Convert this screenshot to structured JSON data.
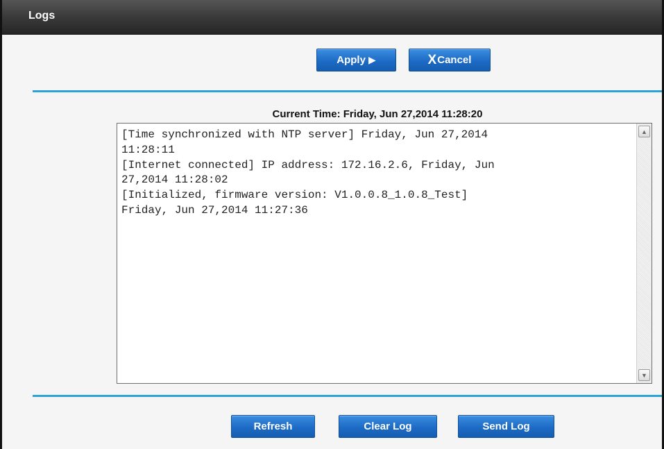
{
  "header": {
    "title": "Logs"
  },
  "toolbar": {
    "apply_label": "Apply",
    "cancel_label": "Cancel"
  },
  "status": {
    "current_time": "Current Time: Friday, Jun 27,2014 11:28:20"
  },
  "log": {
    "text": "[Time synchronized with NTP server] Friday, Jun 27,2014\n11:28:11\n[Internet connected] IP address: 172.16.2.6, Friday, Jun\n27,2014 11:28:02\n[Initialized, firmware version: V1.0.0.8_1.0.8_Test]\nFriday, Jun 27,2014 11:27:36"
  },
  "actions": {
    "refresh_label": "Refresh",
    "clear_log_label": "Clear Log",
    "send_log_label": "Send Log"
  },
  "colors": {
    "header_bg": "#2e2e2e",
    "button_blue": "#1d6bc6",
    "rule_blue": "#2aa3d8"
  },
  "icons": {
    "apply": "play-arrow-icon",
    "cancel": "x-icon"
  }
}
